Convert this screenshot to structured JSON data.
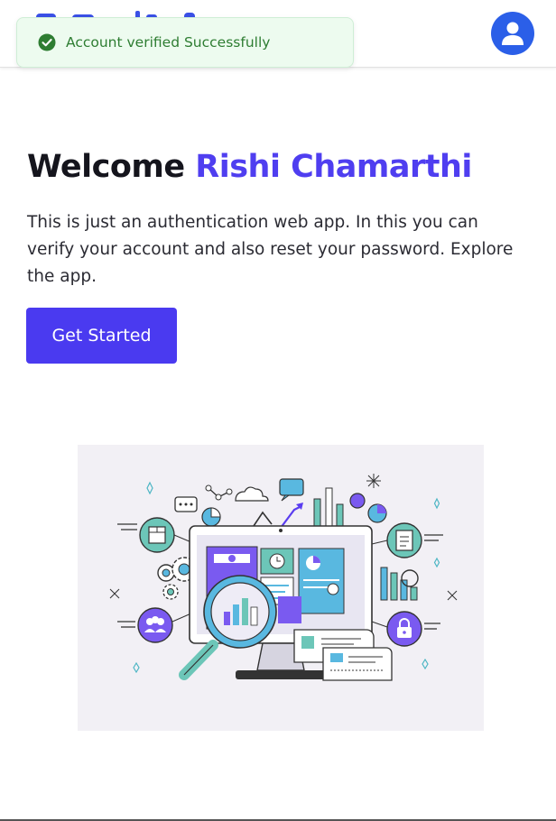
{
  "toast": {
    "message": "Account verified Successfully",
    "status_color": "#2e7d32"
  },
  "header": {
    "user_icon": "user-avatar-icon",
    "accent": "#2b5fe8"
  },
  "hero": {
    "greeting": "Welcome",
    "user_name": "Rishi Chamarthi",
    "description": "This is just an authentication web app. In this you can verify your account and also reset your password. Explore the app.",
    "cta_label": "Get Started",
    "accent": "#4f3ef0"
  },
  "illustration": {
    "icon": "data-analytics-illustration"
  }
}
